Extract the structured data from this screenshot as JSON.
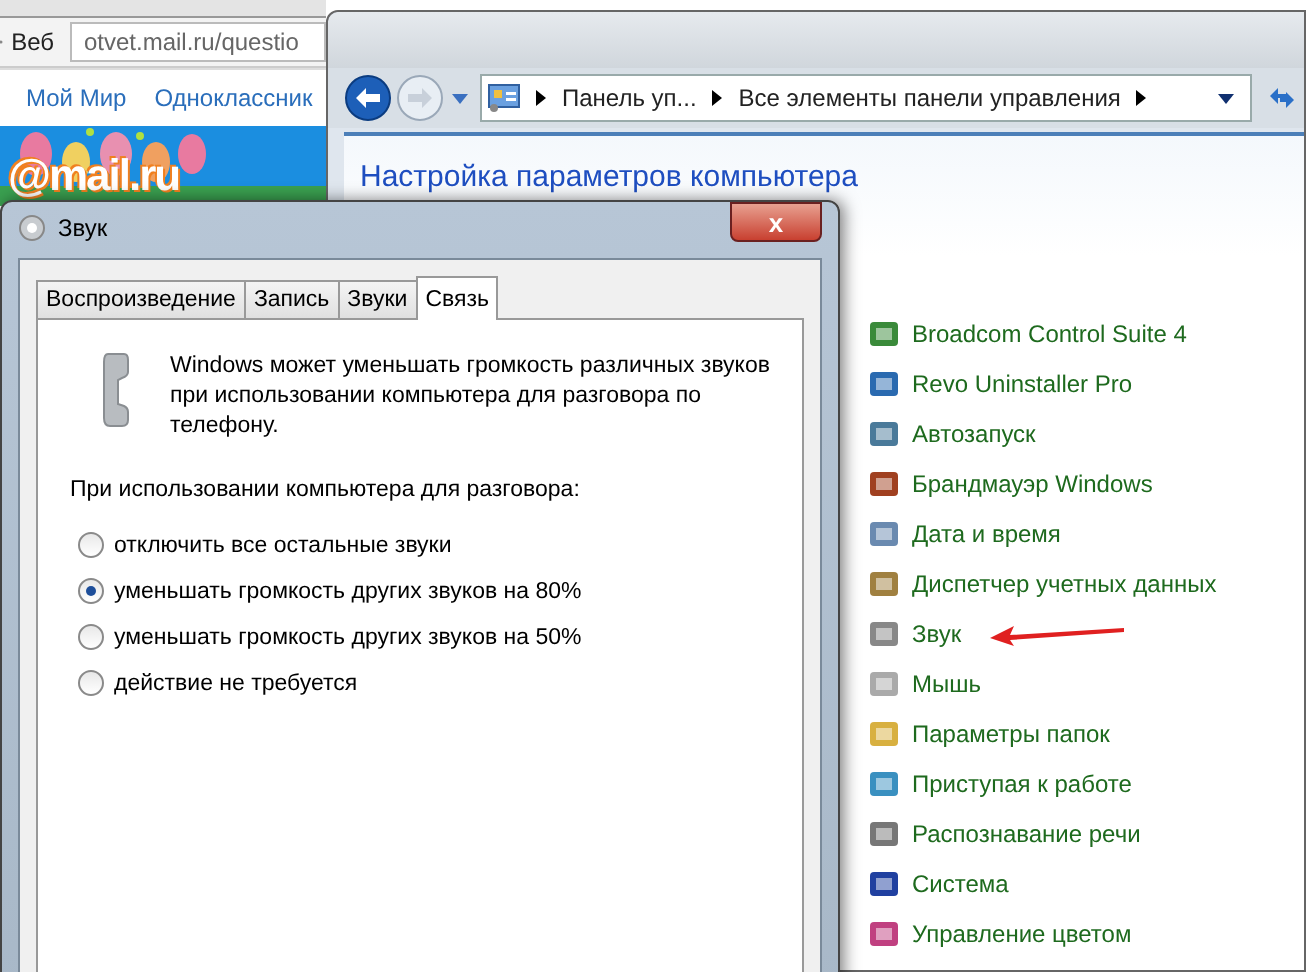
{
  "browser": {
    "search_label": "Веб",
    "address": "otvet.mail.ru/questio",
    "nav_links": [
      "Мой Мир",
      "Одноклассник"
    ],
    "logo": "@mail.ru"
  },
  "control_panel": {
    "breadcrumbs": [
      "Панель уп...",
      "Все элементы панели управления"
    ],
    "heading": "Настройка параметров компьютера",
    "items": [
      {
        "label": "Broadcom Control Suite 4"
      },
      {
        "label": "Revo Uninstaller Pro"
      },
      {
        "label": "Автозапуск"
      },
      {
        "label": "Брандмауэр Windows"
      },
      {
        "label": "Дата и время"
      },
      {
        "label": "Диспетчер учетных данных"
      },
      {
        "label": "Звук"
      },
      {
        "label": "Мышь"
      },
      {
        "label": "Параметры папок"
      },
      {
        "label": "Приступая к работе"
      },
      {
        "label": "Распознавание речи"
      },
      {
        "label": "Система"
      },
      {
        "label": "Управление цветом"
      }
    ]
  },
  "dialog": {
    "title": "Звук",
    "close": "x",
    "tabs": [
      {
        "label": "Воспроизведение",
        "selected": false
      },
      {
        "label": "Запись",
        "selected": false
      },
      {
        "label": "Звуки",
        "selected": false
      },
      {
        "label": "Связь",
        "selected": true
      }
    ],
    "description": "Windows может уменьшать громкость различных звуков при использовании компьютера для разговора по телефону.",
    "group_label": "При использовании компьютера для разговора:",
    "options": [
      {
        "label": "отключить все остальные звуки",
        "selected": false
      },
      {
        "label": "уменьшать громкость других звуков на 80%",
        "selected": true
      },
      {
        "label": "уменьшать громкость других звуков на 50%",
        "selected": false
      },
      {
        "label": "действие не требуется",
        "selected": false
      }
    ]
  }
}
